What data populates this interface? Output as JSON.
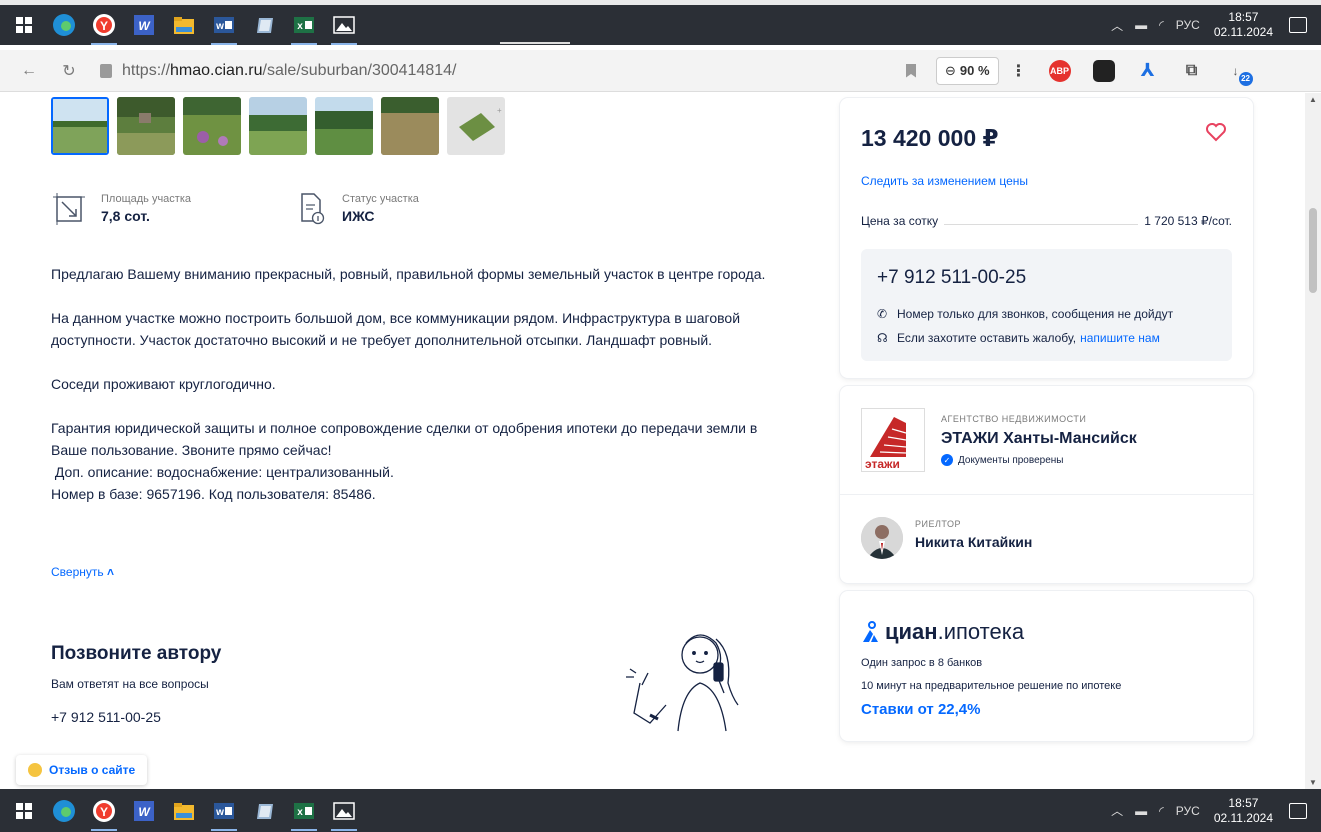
{
  "taskbar": {
    "tray": {
      "lang": "РУС",
      "time": "18:57",
      "date": "02.11.2024"
    }
  },
  "browser": {
    "url_prefix": "https://",
    "url_host": "hmao.cian.ru",
    "url_path": "/sale/suburban/300414814/",
    "zoom": "90 %",
    "ext_abp": "ABP",
    "ext_badge": "22"
  },
  "listing": {
    "params": [
      {
        "label": "Площадь участка",
        "value": "7,8 сот."
      },
      {
        "label": "Статус участка",
        "value": "ИЖС"
      }
    ],
    "description": [
      "Предлагаю Вашему вниманию прекрасный, ровный, правильной формы земельный участок в центре города.",
      "На данном участке можно построить большой дом, все коммуникации рядом. Инфраструктура в шаговой доступности. Участок достаточно высокий и не требует дополнительной отсыпки. Ландшафт ровный.",
      "Соседи проживают круглогодично.",
      "Гарантия юридической защиты и полное сопровождение сделки от одобрения ипотеки до передачи земли в Ваше пользование. Звоните прямо сейчас!",
      " Доп. описание: водоснабжение: централизованный.",
      "Номер в базе: 9657196. Код пользователя: 85486."
    ],
    "collapse_label": "Свернуть",
    "call_heading": "Позвоните автору",
    "call_sub": "Вам ответят на все вопросы",
    "call_phone": "+7 912 511-00-25",
    "feedback_label": "Отзыв о сайте"
  },
  "price_card": {
    "price": "13 420 000 ₽",
    "follow_label": "Следить за изменением цены",
    "ppu_label": "Цена за сотку",
    "ppu_value": "1 720 513 ₽/сот.",
    "phone": "+7 912 511-00-25",
    "note_calls": "Номер только для звонков, сообщения не дойдут",
    "note_complaint": "Если захотите оставить жалобу,",
    "note_link": "напишите нам"
  },
  "agent_card": {
    "agency_type": "АГЕНТСТВО НЕДВИЖИМОСТИ",
    "agency_name": "ЭТАЖИ Ханты-Мансийск",
    "verified": "Документы проверены",
    "logo_text": "этажи",
    "realtor_type": "РИЕЛТОР",
    "realtor_name": "Никита Китайкин"
  },
  "ipoteka_card": {
    "brand": "циан",
    "brand_suffix": ".ипотека",
    "line1": "Один запрос в 8 банков",
    "line2": "10 минут на предварительное решение по ипотеке",
    "rate": "Ставки от 22,4%"
  },
  "colors": {
    "accent": "#0468ff",
    "text": "#152242",
    "heart": "#e84260",
    "taskbar": "#2b2f36"
  }
}
